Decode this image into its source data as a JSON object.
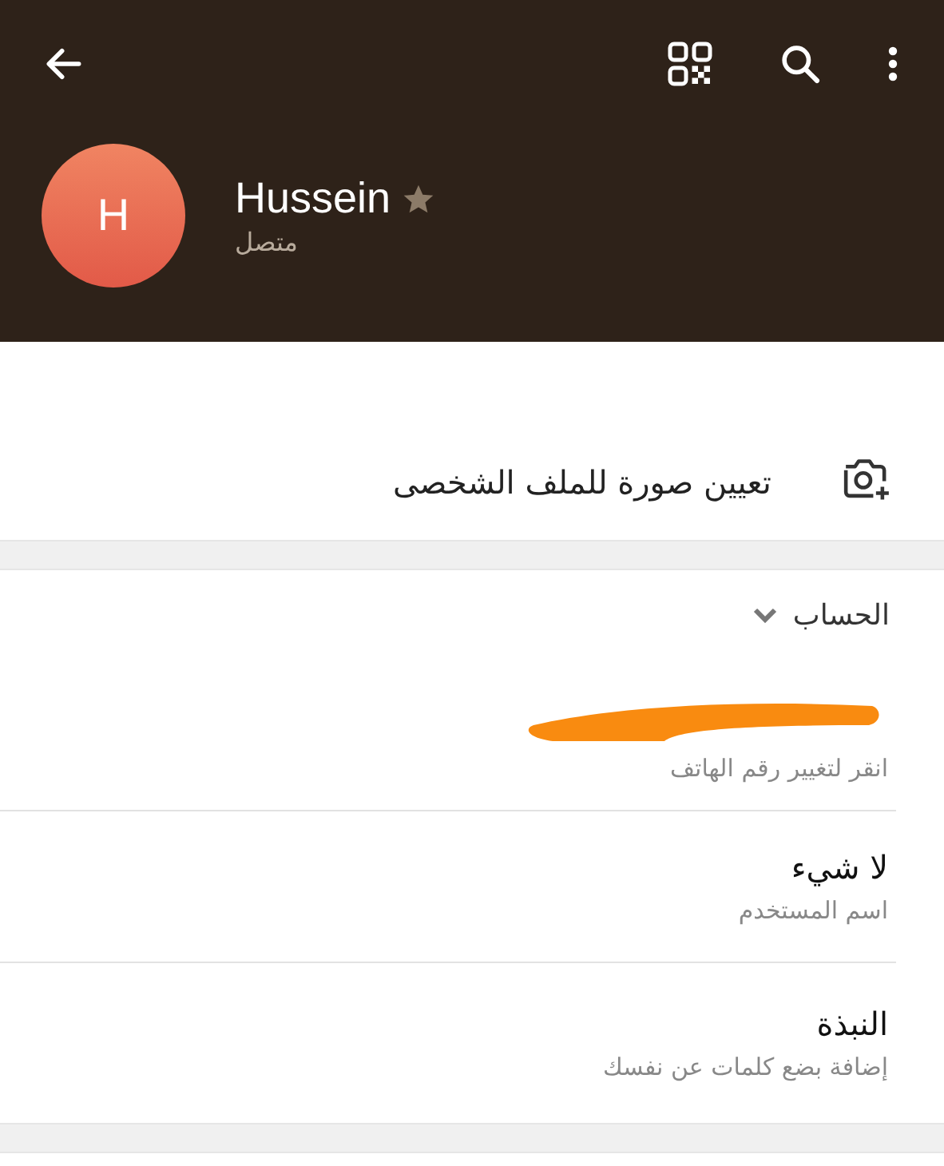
{
  "profile": {
    "initial": "H",
    "name": "Hussein",
    "starred": true,
    "status": "متصل"
  },
  "set_photo": {
    "label": "تعيين صورة للملف الشخصى"
  },
  "section": {
    "title": "الحساب",
    "expanded": true
  },
  "rows": [
    {
      "kind": "redacted",
      "subtitle": "انقر لتغيير رقم الهاتف"
    },
    {
      "kind": "text",
      "value": "لا شيء",
      "subtitle": "اسم المستخدم"
    },
    {
      "kind": "text",
      "value": "النبذة",
      "subtitle": "إضافة بضع كلمات عن نفسك"
    }
  ]
}
